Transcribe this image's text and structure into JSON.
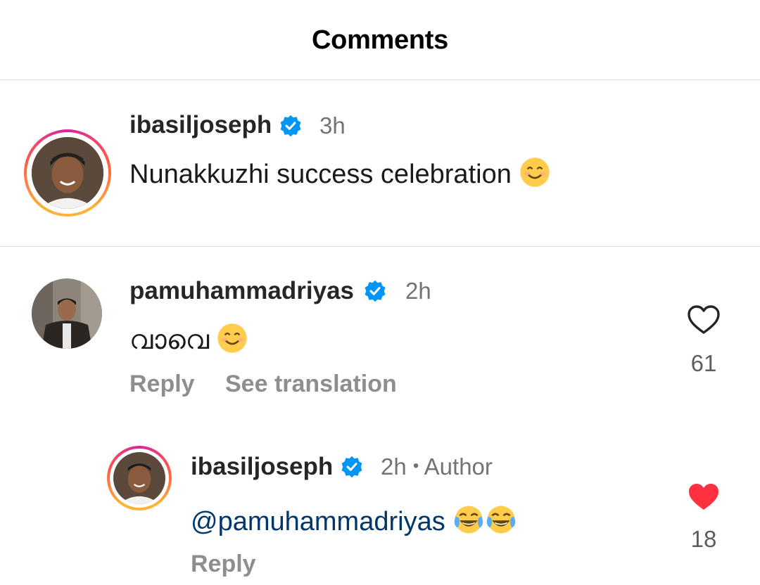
{
  "header": {
    "title": "Comments"
  },
  "caption": {
    "username": "ibasiljoseph",
    "time": "3h",
    "text": "Nunakkuzhi success celebration",
    "emoji": "smiling-face-emoji"
  },
  "comment": {
    "username": "pamuhammadriyas",
    "time": "2h",
    "text": "വാവെ",
    "emoji": "smiling-face-emoji",
    "reply_label": "Reply",
    "translate_label": "See translation",
    "like_count": "61",
    "liked": false
  },
  "reply": {
    "username": "ibasiljoseph",
    "time": "2h",
    "separator": "•",
    "author_label": "Author",
    "mention": "@pamuhammadriyas",
    "emoji": "face-with-tears-of-joy-emoji",
    "reply_label": "Reply",
    "like_count": "18",
    "liked": true
  },
  "colors": {
    "verified_blue": "#0095f6",
    "like_red": "#ff3040",
    "mention_blue": "#00376b",
    "secondary_text": "#737373"
  }
}
